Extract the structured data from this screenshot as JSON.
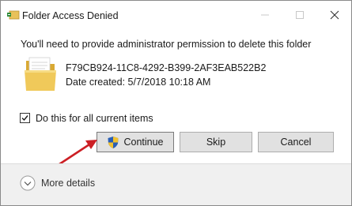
{
  "window": {
    "title": "Folder Access Denied",
    "icon": "folder-app-icon",
    "controls": [
      "minimize-icon",
      "maximize-icon",
      "close-icon"
    ]
  },
  "message": "You'll need to provide administrator permission to delete this folder",
  "item": {
    "name": "F79CB924-11C8-4292-B399-2AF3EAB522B2",
    "date_created": "Date created: 5/7/2018 10:18 AM",
    "icon": "folder-icon"
  },
  "apply_all": {
    "label": "Do this for all current items",
    "checked": true
  },
  "buttons": {
    "continue": "Continue",
    "skip": "Skip",
    "cancel": "Cancel"
  },
  "more_details": "More details",
  "colors": {
    "arrow": "#cc1f24",
    "folder": "#e8c15a"
  }
}
